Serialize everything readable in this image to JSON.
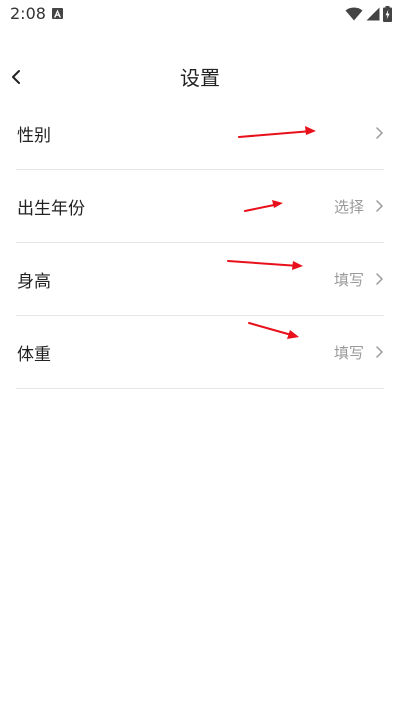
{
  "status_bar": {
    "time": "2:08",
    "icons": [
      "app-notification-icon",
      "wifi-icon",
      "cell-signal-icon",
      "battery-charging-icon"
    ]
  },
  "header": {
    "title": "设置",
    "back_icon": "chevron-left-icon"
  },
  "settings": [
    {
      "label": "性别",
      "value": ""
    },
    {
      "label": "出生年份",
      "value": "选择"
    },
    {
      "label": "身高",
      "value": "填写"
    },
    {
      "label": "体重",
      "value": "填写"
    }
  ],
  "annotation": {
    "arrow_color": "#e8101a"
  }
}
